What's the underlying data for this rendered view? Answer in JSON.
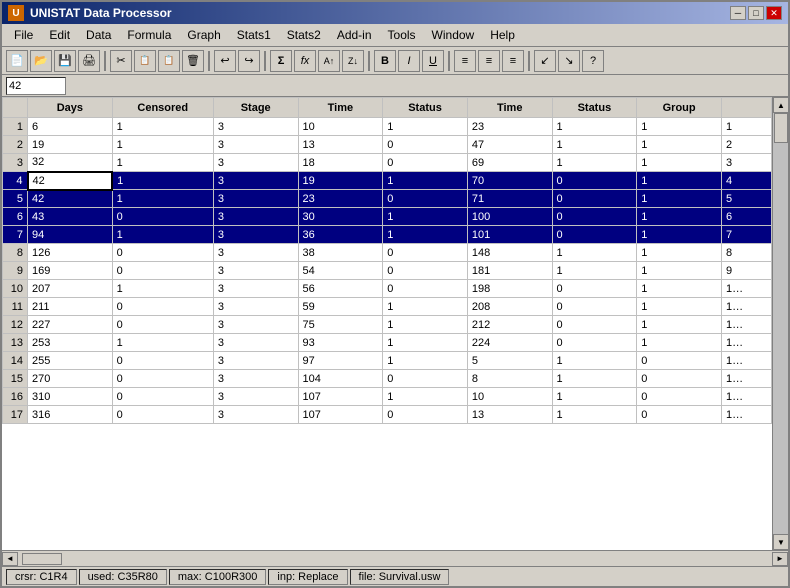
{
  "window": {
    "title": "UNISTAT Data Processor",
    "minimize_label": "─",
    "maximize_label": "□",
    "close_label": "✕"
  },
  "menu": {
    "items": [
      "File",
      "Edit",
      "Data",
      "Formula",
      "Graph",
      "Stats1",
      "Stats2",
      "Add-in",
      "Tools",
      "Window",
      "Help"
    ]
  },
  "toolbar": {
    "buttons": [
      "📁",
      "💾",
      "🖨",
      "|",
      "✂",
      "📋",
      "📋",
      "🗑",
      "|",
      "↩",
      "↪",
      "|",
      "Σ",
      "fx",
      "A↑",
      "Z↑",
      "|",
      "B",
      "I",
      "U",
      "|",
      "≡",
      "≡",
      "≡",
      "|",
      "↙",
      "↘",
      "?"
    ]
  },
  "formula_bar": {
    "cell_ref": "42"
  },
  "columns": [
    "Days",
    "Censored",
    "Stage",
    "Time",
    "Status",
    "Time",
    "Status",
    "Group"
  ],
  "rows": [
    {
      "num": 1,
      "selected": false,
      "cells": [
        6,
        1,
        3,
        10,
        1,
        23,
        1,
        1,
        1
      ]
    },
    {
      "num": 2,
      "selected": false,
      "cells": [
        19,
        1,
        3,
        13,
        0,
        47,
        1,
        1,
        2
      ]
    },
    {
      "num": 3,
      "selected": false,
      "cells": [
        32,
        1,
        3,
        18,
        0,
        69,
        1,
        1,
        3
      ]
    },
    {
      "num": 4,
      "selected": true,
      "cells": [
        42,
        1,
        3,
        19,
        1,
        70,
        0,
        1,
        4
      ],
      "active_col": 0
    },
    {
      "num": 5,
      "selected": true,
      "cells": [
        42,
        1,
        3,
        23,
        0,
        71,
        0,
        1,
        5
      ]
    },
    {
      "num": 6,
      "selected": true,
      "cells": [
        43,
        0,
        3,
        30,
        1,
        100,
        0,
        1,
        6
      ]
    },
    {
      "num": 7,
      "selected": true,
      "cells": [
        94,
        1,
        3,
        36,
        1,
        101,
        0,
        1,
        7
      ]
    },
    {
      "num": 8,
      "selected": false,
      "cells": [
        126,
        0,
        3,
        38,
        0,
        148,
        1,
        1,
        8
      ]
    },
    {
      "num": 9,
      "selected": false,
      "cells": [
        169,
        0,
        3,
        54,
        0,
        181,
        1,
        1,
        9
      ]
    },
    {
      "num": 10,
      "selected": false,
      "cells": [
        207,
        1,
        3,
        56,
        0,
        198,
        0,
        1,
        "1…"
      ]
    },
    {
      "num": 11,
      "selected": false,
      "cells": [
        211,
        0,
        3,
        59,
        1,
        208,
        0,
        1,
        "1…"
      ]
    },
    {
      "num": 12,
      "selected": false,
      "cells": [
        227,
        0,
        3,
        75,
        1,
        212,
        0,
        1,
        "1…"
      ]
    },
    {
      "num": 13,
      "selected": false,
      "cells": [
        253,
        1,
        3,
        93,
        1,
        224,
        0,
        1,
        "1…"
      ]
    },
    {
      "num": 14,
      "selected": false,
      "cells": [
        255,
        0,
        3,
        97,
        1,
        5,
        1,
        0,
        "1…"
      ]
    },
    {
      "num": 15,
      "selected": false,
      "cells": [
        270,
        0,
        3,
        104,
        0,
        8,
        1,
        0,
        "1…"
      ]
    },
    {
      "num": 16,
      "selected": false,
      "cells": [
        310,
        0,
        3,
        107,
        1,
        10,
        1,
        0,
        "1…"
      ]
    },
    {
      "num": 17,
      "selected": false,
      "cells": [
        316,
        0,
        3,
        107,
        0,
        13,
        1,
        0,
        "1…"
      ]
    }
  ],
  "status": {
    "cursor": "crsr: C1R4",
    "used": "used: C35R80",
    "max": "max: C100R300",
    "input": "inp: Replace",
    "file": "file: Survival.usw"
  }
}
